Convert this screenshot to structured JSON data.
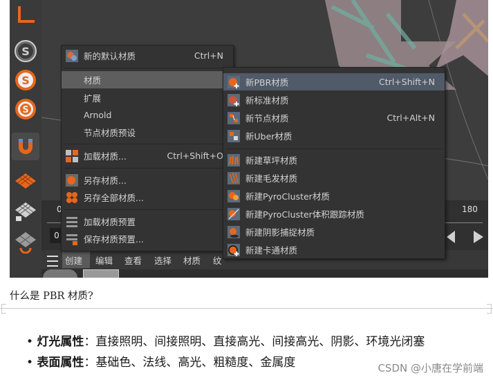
{
  "matbar": {
    "tabs": [
      "创建",
      "编辑",
      "查看",
      "选择",
      "材质",
      "纹"
    ]
  },
  "timeline": {
    "left_value": "0",
    "right_value": "180",
    "frame_field": "0"
  },
  "menu1": {
    "items": [
      {
        "label": "新的默认材质",
        "shortcut": "Ctrl+N"
      },
      {
        "label": "材质",
        "shortcut": ""
      },
      {
        "label": "扩展",
        "shortcut": ""
      },
      {
        "label": "Arnold",
        "shortcut": ""
      },
      {
        "label": "节点材质预设",
        "shortcut": ""
      },
      {
        "label": "加载材质...",
        "shortcut": "Ctrl+Shift+O"
      },
      {
        "label": "另存材质...",
        "shortcut": ""
      },
      {
        "label": "另存全部材质...",
        "shortcut": ""
      },
      {
        "label": "加载材质预置",
        "shortcut": ""
      },
      {
        "label": "保存材质预置...",
        "shortcut": ""
      }
    ]
  },
  "menu2": {
    "items": [
      {
        "label": "新PBR材质",
        "shortcut": "Ctrl+Shift+N"
      },
      {
        "label": "新标准材质",
        "shortcut": ""
      },
      {
        "label": "新节点材质",
        "shortcut": "Ctrl+Alt+N"
      },
      {
        "label": "新Uber材质",
        "shortcut": ""
      },
      {
        "label": "新建草坪材质",
        "shortcut": ""
      },
      {
        "label": "新建毛发材质",
        "shortcut": ""
      },
      {
        "label": "新建PyroCluster材质",
        "shortcut": ""
      },
      {
        "label": "新建PyroCluster体积跟踪材质",
        "shortcut": ""
      },
      {
        "label": "新建阴影捕捉材质",
        "shortcut": ""
      },
      {
        "label": "新建卡通材质",
        "shortcut": ""
      }
    ]
  },
  "article": {
    "question": "什么是 PBR 材质?",
    "bullets": [
      {
        "title": "灯光属性",
        "text": "：直接照明、间接照明、直接高光、间接高光、阴影、环境光闭塞"
      },
      {
        "title": "表面属性",
        "text": "：基础色、法线、高光、粗糙度、金属度"
      }
    ]
  },
  "watermark": "CSDN @小唐在学前端",
  "colors": {
    "highlight": "#505a68",
    "menu_bg": "#333333",
    "icon_orange": "#e8661c"
  },
  "icons": [
    "corner-axis-icon",
    "spline-s-icon",
    "spline-orange-icon",
    "spline-outline-icon",
    "magnet-icon",
    "floor-grid-icon",
    "lock-grid-icon",
    "sync-grid-icon",
    "hamburger-icon",
    "material-icon",
    "submenu-arrow-icon"
  ]
}
